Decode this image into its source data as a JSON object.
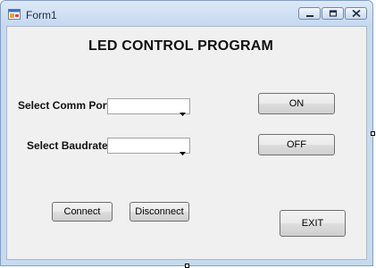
{
  "window": {
    "title": "Form1"
  },
  "form": {
    "heading": "LED CONTROL PROGRAM",
    "comm_port": {
      "label": "Select Comm Port",
      "value": ""
    },
    "baudrate": {
      "label": "Select Baudrate",
      "value": ""
    },
    "buttons": {
      "on": "ON",
      "off": "OFF",
      "connect": "Connect",
      "disconnect": "Disconnect",
      "exit": "EXIT"
    }
  },
  "icons": {
    "app": "form-app-icon",
    "minimize": "minimize-icon",
    "maximize": "maximize-icon",
    "close": "close-icon",
    "dropdown": "chevron-down-icon"
  }
}
